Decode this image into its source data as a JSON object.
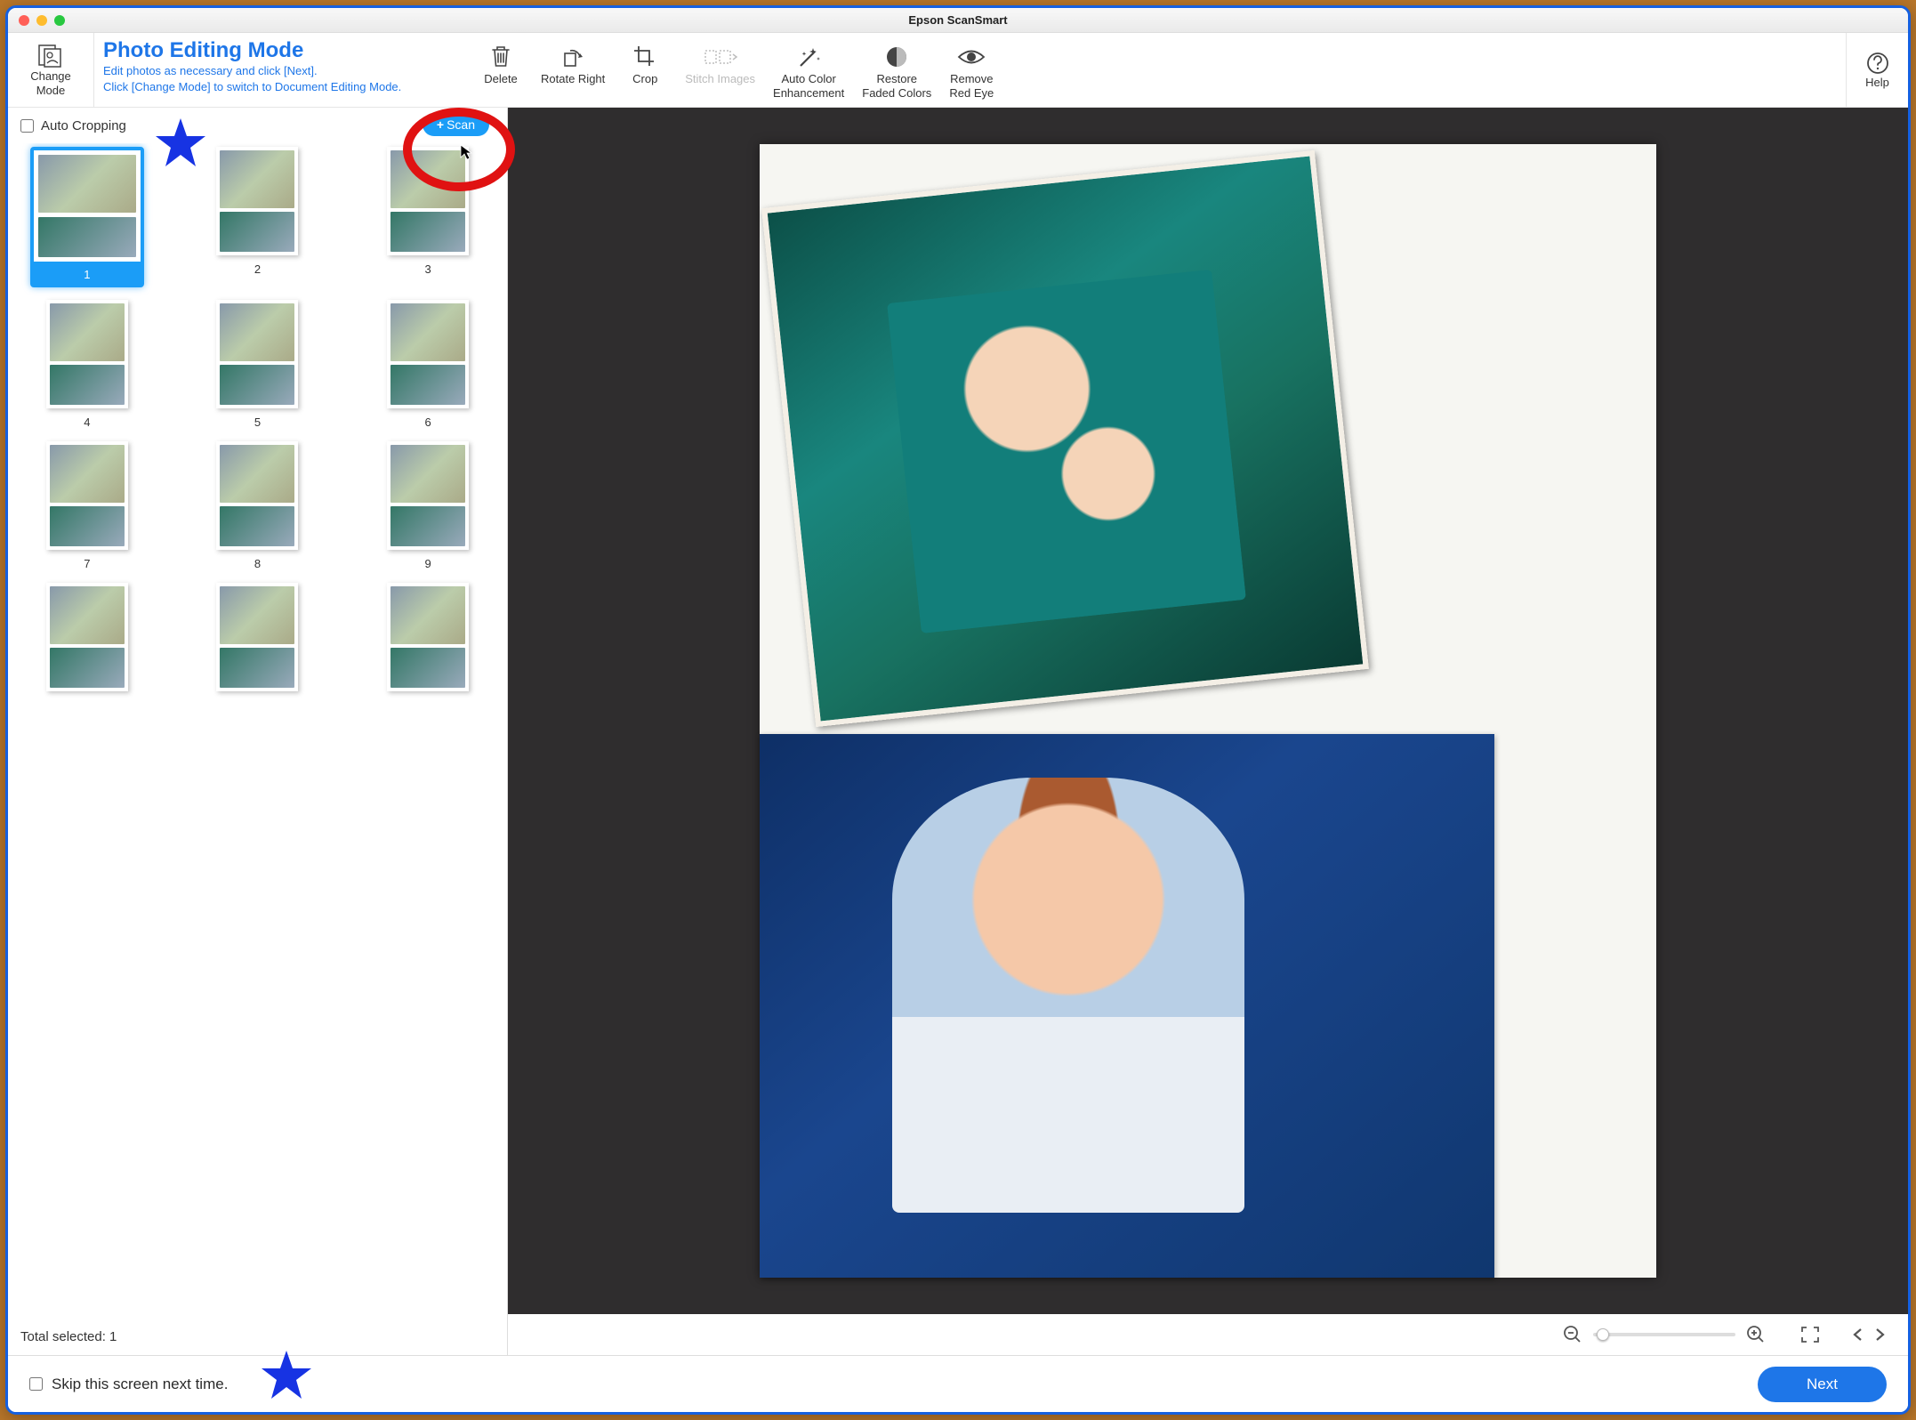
{
  "window": {
    "title": "Epson ScanSmart"
  },
  "header": {
    "change_mode": "Change\nMode",
    "mode_title": "Photo Editing Mode",
    "mode_line1": "Edit photos as necessary and click [Next].",
    "mode_line2": "Click [Change Mode] to switch to Document Editing Mode."
  },
  "toolbar": {
    "delete": "Delete",
    "rotate_right": "Rotate Right",
    "crop": "Crop",
    "stitch_images": "Stitch Images",
    "auto_color": "Auto Color\nEnhancement",
    "restore_faded": "Restore\nFaded Colors",
    "remove_red_eye": "Remove\nRed Eye",
    "help": "Help"
  },
  "left": {
    "auto_cropping": "Auto Cropping",
    "scan_button": "Scan",
    "thumbs": [
      "1",
      "2",
      "3",
      "4",
      "5",
      "6",
      "7",
      "8",
      "9",
      "",
      "",
      ""
    ],
    "selected_index": 0,
    "total_selected": "Total selected: 1"
  },
  "footer": {
    "skip_label": "Skip this screen next time.",
    "next": "Next"
  },
  "annotations": {
    "star1": true,
    "star2": true,
    "red_circle": true
  }
}
